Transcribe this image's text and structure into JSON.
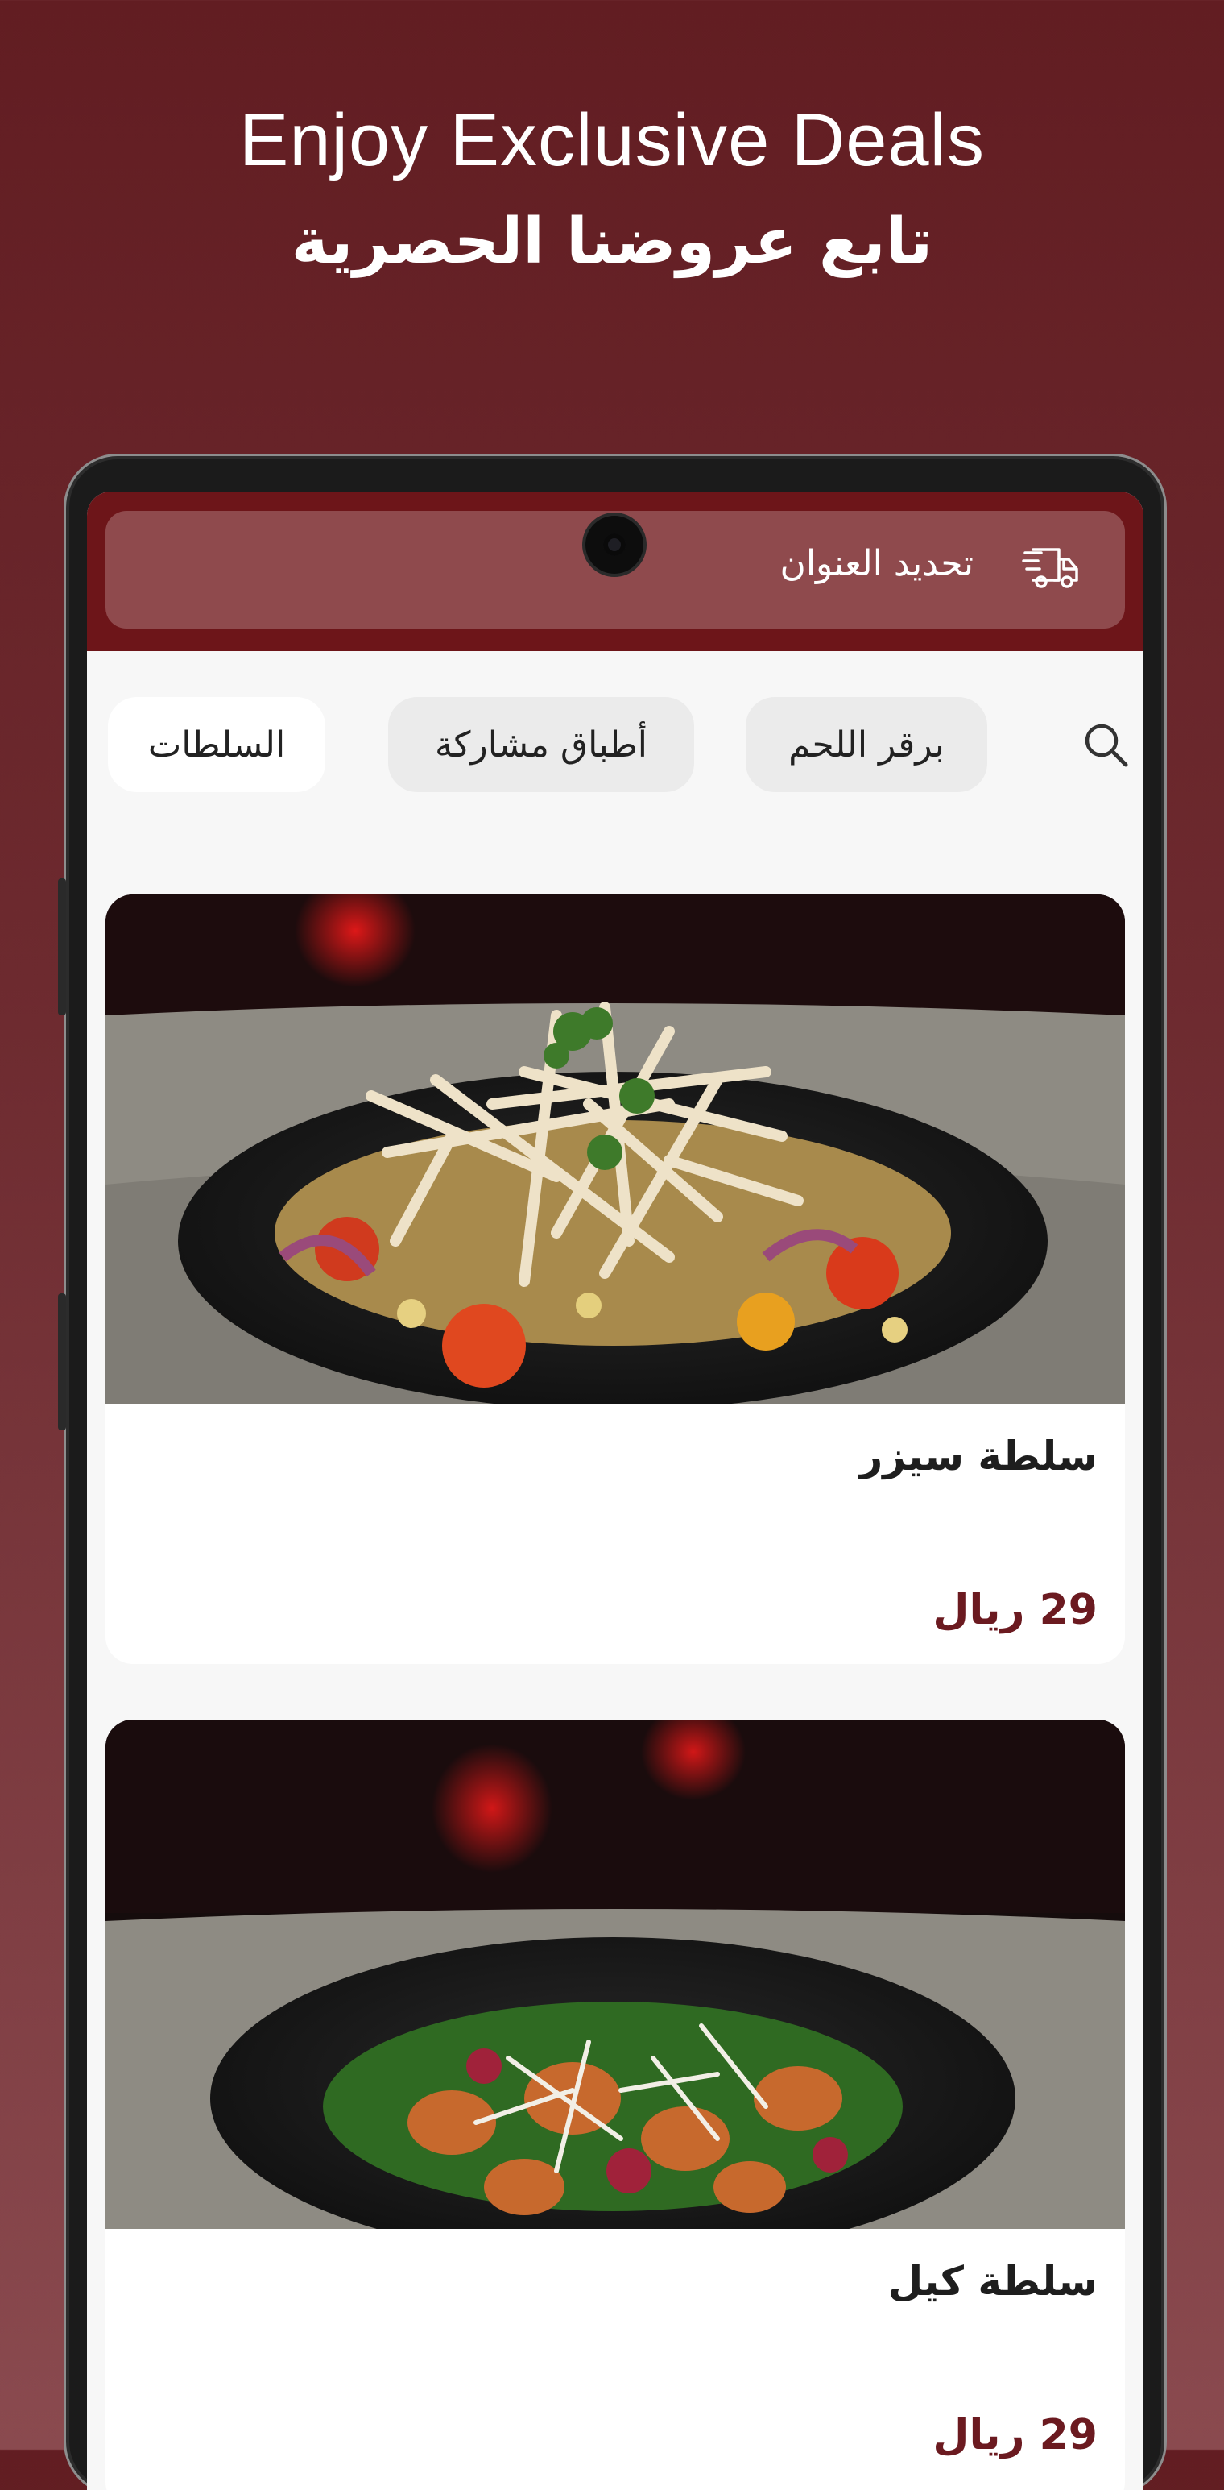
{
  "promo": {
    "title_en": "Enjoy Exclusive Deals",
    "title_ar": "تابع عروضنا الحصرية"
  },
  "header": {
    "address_label": "تحديد العنوان",
    "icon": "delivery-truck-icon"
  },
  "categories": [
    {
      "label": "برقر اللحم",
      "active": false
    },
    {
      "label": "أطباق مشاركة",
      "active": false
    },
    {
      "label": "السلطات",
      "active": true
    }
  ],
  "search": {
    "icon": "search-icon"
  },
  "menu_items": [
    {
      "name": "سلطة سيزر",
      "price": "29 ريال"
    },
    {
      "name": "سلطة كيل",
      "price": "29 ريال"
    }
  ],
  "colors": {
    "brand": "#6d1519",
    "price": "#6b1a20",
    "address_bar": "#8f4a4d"
  }
}
